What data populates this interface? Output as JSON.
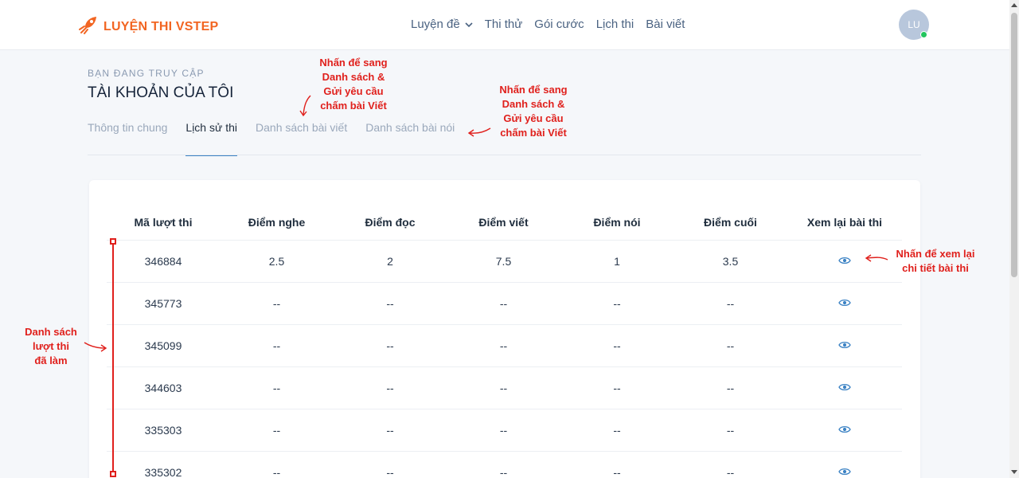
{
  "brand": {
    "name": "LUYỆN THI VSTEP",
    "color": "#f26522"
  },
  "nav": {
    "items": [
      {
        "label": "Luyện đề",
        "has_dropdown": true
      },
      {
        "label": "Thi thử"
      },
      {
        "label": "Gói cước"
      },
      {
        "label": "Lịch thi"
      },
      {
        "label": "Bài viết"
      }
    ]
  },
  "user": {
    "initials": "LU",
    "status_color": "#22c55e"
  },
  "account": {
    "kicker": "BẠN ĐANG TRUY CẬP",
    "title": "TÀI KHOẢN CỦA TÔI",
    "tabs": [
      {
        "label": "Thông tin chung",
        "active": false
      },
      {
        "label": "Lịch sử thi",
        "active": true
      },
      {
        "label": "Danh sách bài viết",
        "active": false
      },
      {
        "label": "Danh sách bài nói",
        "active": false
      }
    ]
  },
  "table": {
    "headers": [
      "Mã lượt thi",
      "Điểm nghe",
      "Điểm đọc",
      "Điểm viết",
      "Điểm nói",
      "Điểm cuối",
      "Xem lại bài thi"
    ],
    "rows": [
      [
        "346884",
        "2.5",
        "2",
        "7.5",
        "1",
        "3.5"
      ],
      [
        "345773",
        "--",
        "--",
        "--",
        "--",
        "--"
      ],
      [
        "345099",
        "--",
        "--",
        "--",
        "--",
        "--"
      ],
      [
        "344603",
        "--",
        "--",
        "--",
        "--",
        "--"
      ],
      [
        "335303",
        "--",
        "--",
        "--",
        "--",
        "--"
      ],
      [
        "335302",
        "--",
        "--",
        "--",
        "--",
        "--"
      ]
    ],
    "view_icon": "eye-icon",
    "accent": "#3b82c4"
  },
  "annotations": {
    "color": "#e0201c",
    "writing": [
      "Nhấn để sang",
      "Danh sách &",
      "Gửi yêu cầu",
      "chấm bài Viết"
    ],
    "speaking": [
      "Nhấn để sang",
      "Danh sách &",
      "Gửi yêu cầu",
      "chấm bài Viết"
    ],
    "review": [
      "Nhấn để xem lại",
      "chi tiết bài thi"
    ],
    "attempts": [
      "Danh sách",
      "lượt thi",
      "đã làm"
    ]
  }
}
